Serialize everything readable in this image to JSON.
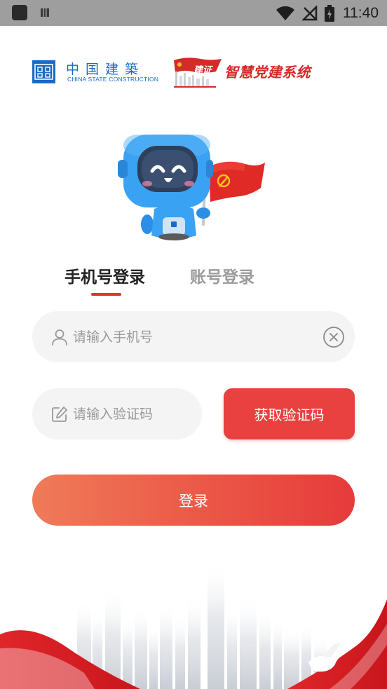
{
  "status_bar": {
    "time": "11:40",
    "icons": [
      "notification-square-icon",
      "sim-card-icon",
      "wifi-icon",
      "no-signal-icon",
      "battery-charging-icon"
    ]
  },
  "logos": {
    "cscec_chinese": "中国建築",
    "cscec_english": "CHINA STATE CONSTRUCTION",
    "party_brand": "建证",
    "party_system_title": "智慧党建系统"
  },
  "tabs": [
    {
      "label": "手机号登录",
      "active": true
    },
    {
      "label": "账号登录",
      "active": false
    }
  ],
  "form": {
    "phone": {
      "placeholder": "请输入手机号",
      "value": ""
    },
    "code": {
      "placeholder": "请输入验证码",
      "value": ""
    },
    "get_code_label": "获取验证码",
    "login_label": "登录"
  },
  "colors": {
    "accent_red": "#e8413f",
    "brand_blue": "#1a6bc6",
    "gradient_start": "#ef7b59",
    "gradient_end": "#e63b3b"
  }
}
